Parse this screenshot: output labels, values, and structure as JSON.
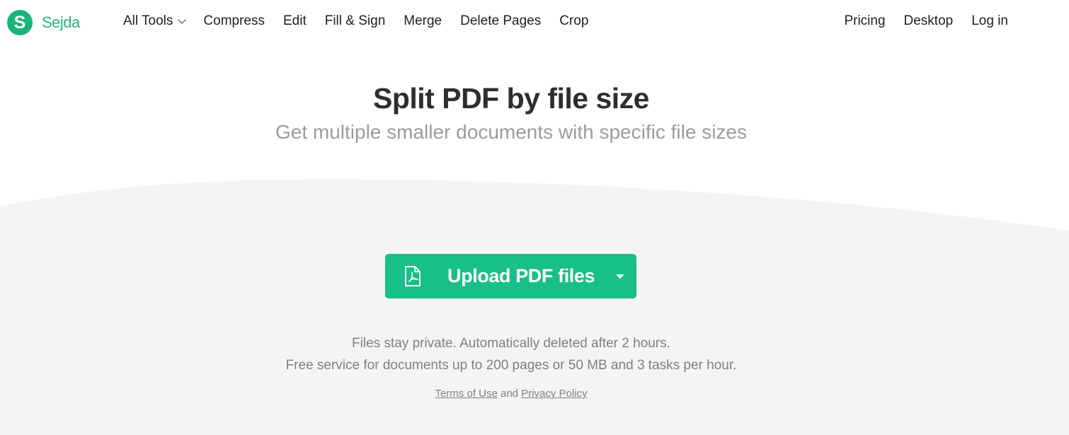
{
  "brand": {
    "logo_letter": "S",
    "name": "Sejda",
    "color": "#18b47a"
  },
  "nav": {
    "left": [
      {
        "label": "All Tools",
        "has_dropdown": true
      },
      {
        "label": "Compress"
      },
      {
        "label": "Edit"
      },
      {
        "label": "Fill & Sign"
      },
      {
        "label": "Merge"
      },
      {
        "label": "Delete Pages"
      },
      {
        "label": "Crop"
      }
    ],
    "right": [
      {
        "label": "Pricing"
      },
      {
        "label": "Desktop"
      },
      {
        "label": "Log in"
      }
    ]
  },
  "hero": {
    "title": "Split PDF by file size",
    "subtitle": "Get multiple smaller documents with specific file sizes"
  },
  "upload": {
    "label": "Upload PDF files",
    "icon": "pdf-file-icon",
    "dropdown_icon": "caret-down-icon",
    "color": "#19bf88"
  },
  "info": {
    "line1": "Files stay private. Automatically deleted after 2 hours.",
    "line2": "Free service for documents up to 200 pages or 50 MB and 3 tasks per hour."
  },
  "legal": {
    "terms": "Terms of Use",
    "and": " and ",
    "privacy": "Privacy Policy"
  }
}
